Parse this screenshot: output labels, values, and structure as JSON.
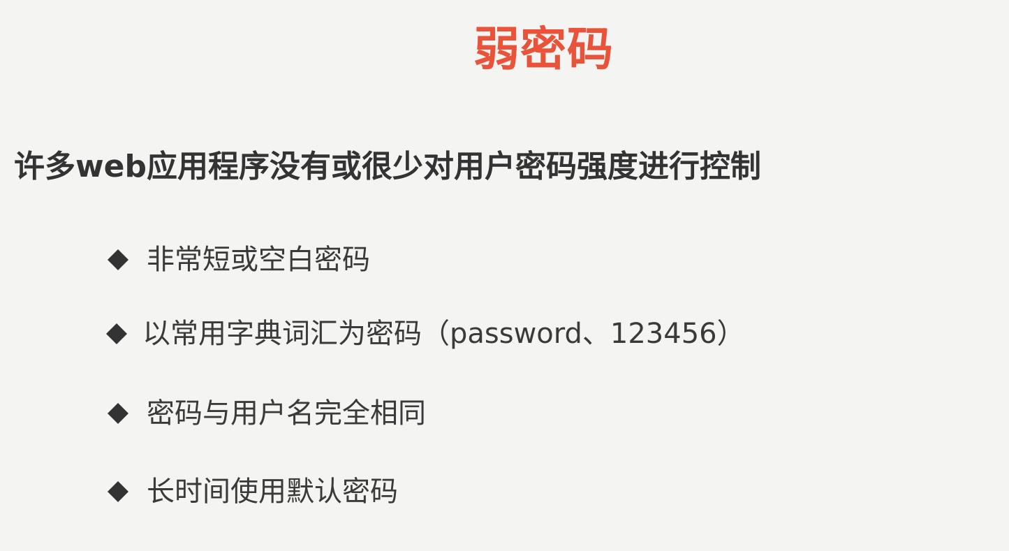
{
  "slide": {
    "title": "弱密码",
    "title_color": "#e8533a",
    "subtitle": "许多web应用程序没有或很少对用户密码强度进行控制",
    "bullet_icon": "diamond-bullet-icon",
    "bullets": [
      {
        "text": "非常短或空白密码"
      },
      {
        "text": "以常用字典词汇为密码（password、123456）"
      },
      {
        "text": "密码与用户名完全相同"
      },
      {
        "text": "长时间使用默认密码"
      }
    ]
  }
}
